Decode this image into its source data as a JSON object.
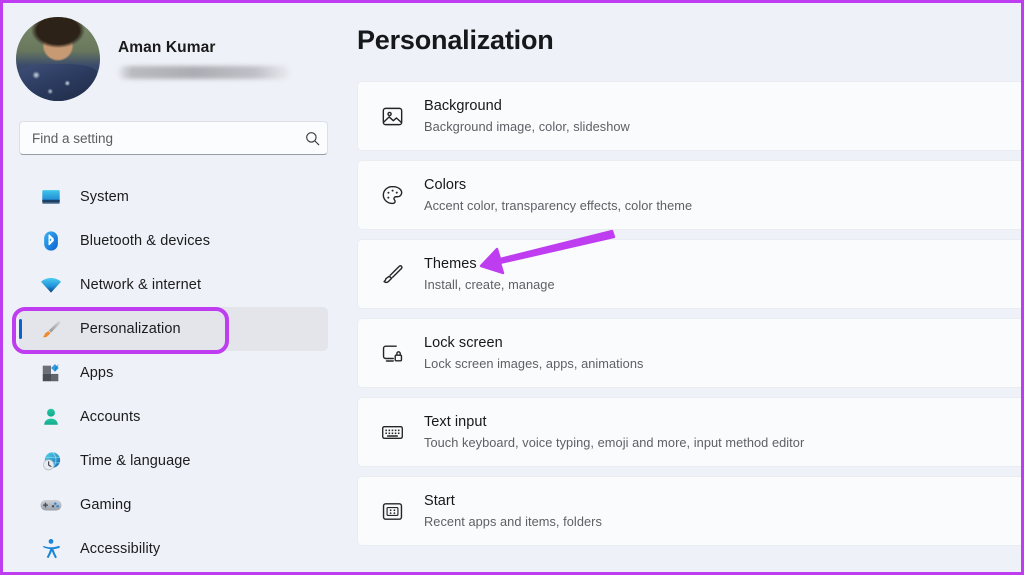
{
  "window": {
    "app": "Settings",
    "accent_color": "#0a63c9",
    "sidebar_bg": "#eef1f7",
    "card_bg": "#fafbfd",
    "annotation_color": "#bf3df0"
  },
  "sidebar": {
    "account": {
      "name": "Aman Kumar",
      "email_redacted": true,
      "avatar_name": "user-avatar"
    },
    "search": {
      "placeholder": "Find a setting",
      "value": "",
      "icon": "search-icon"
    },
    "items": [
      {
        "label": "System",
        "icon": "monitor-icon",
        "key": "system",
        "selected": false
      },
      {
        "label": "Bluetooth & devices",
        "icon": "bluetooth-icon",
        "key": "bluetooth",
        "selected": false
      },
      {
        "label": "Network & internet",
        "icon": "wifi-icon",
        "key": "network",
        "selected": false
      },
      {
        "label": "Personalization",
        "icon": "paintbrush-icon",
        "key": "personalization",
        "selected": true
      },
      {
        "label": "Apps",
        "icon": "apps-icon",
        "key": "apps",
        "selected": false
      },
      {
        "label": "Accounts",
        "icon": "person-icon",
        "key": "accounts",
        "selected": false
      },
      {
        "label": "Time & language",
        "icon": "clock-globe-icon",
        "key": "time",
        "selected": false
      },
      {
        "label": "Gaming",
        "icon": "gamepad-icon",
        "key": "gaming",
        "selected": false
      },
      {
        "label": "Accessibility",
        "icon": "accessibility-icon",
        "key": "accessibility",
        "selected": false
      }
    ]
  },
  "main": {
    "title": "Personalization",
    "cards": [
      {
        "title": "Background",
        "subtitle": "Background image, color, slideshow",
        "icon": "image-icon",
        "key": "background"
      },
      {
        "title": "Colors",
        "subtitle": "Accent color, transparency effects, color theme",
        "icon": "palette-icon",
        "key": "colors"
      },
      {
        "title": "Themes",
        "subtitle": "Install, create, manage",
        "icon": "paintbrush-icon",
        "key": "themes"
      },
      {
        "title": "Lock screen",
        "subtitle": "Lock screen images, apps, animations",
        "icon": "lock-screen-icon",
        "key": "lock-screen"
      },
      {
        "title": "Text input",
        "subtitle": "Touch keyboard, voice typing, emoji and more, input method editor",
        "icon": "keyboard-icon",
        "key": "text-input"
      },
      {
        "title": "Start",
        "subtitle": "Recent apps and items, folders",
        "icon": "start-icon",
        "key": "start"
      }
    ]
  },
  "annotations": {
    "highlight_target": "Personalization",
    "arrow_target": "Themes",
    "color": "#bf3df0"
  }
}
